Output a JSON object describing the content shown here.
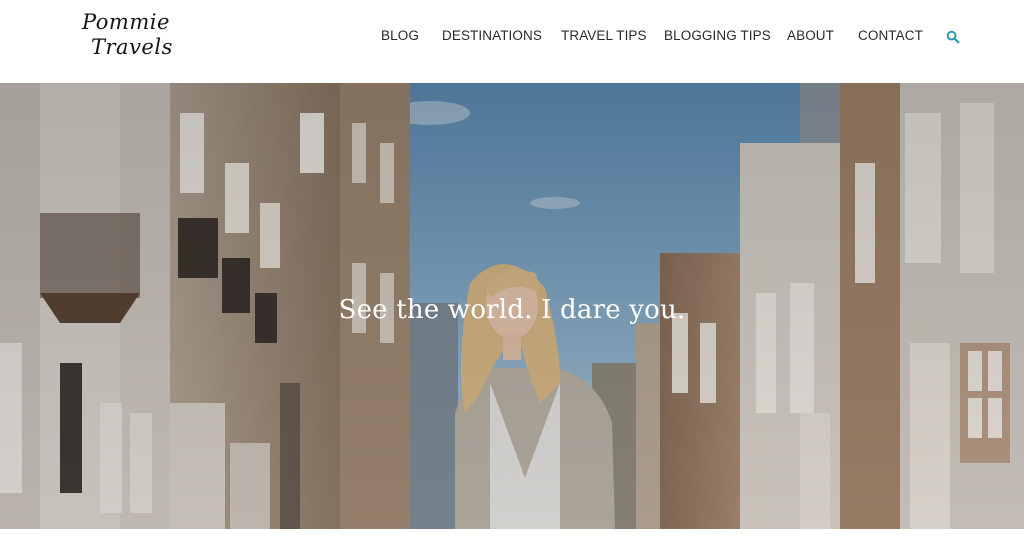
{
  "brand": {
    "line1": "Pommie",
    "line2": "Travels"
  },
  "nav": {
    "items": [
      {
        "label": "BLOG"
      },
      {
        "label": "DESTINATIONS"
      },
      {
        "label": "TRAVEL TIPS"
      },
      {
        "label": "BLOGGING TIPS"
      },
      {
        "label": "ABOUT"
      },
      {
        "label": "CONTACT"
      }
    ],
    "search_icon": "search-icon"
  },
  "hero": {
    "tagline": "See the world. I dare you."
  },
  "colors": {
    "accent": "#2a9bb0",
    "nav_text": "#2a2a2a",
    "hero_text": "#ffffff"
  }
}
